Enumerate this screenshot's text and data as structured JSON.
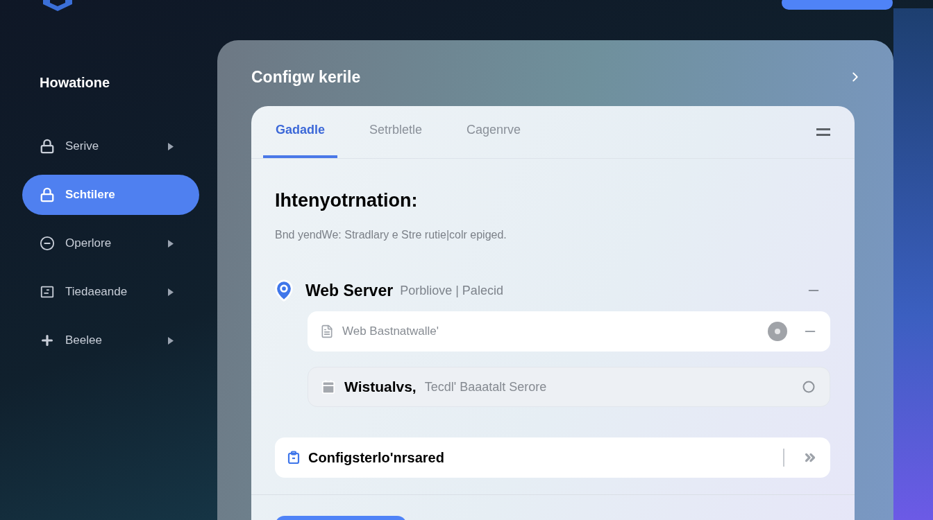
{
  "sidebar": {
    "heading": "Howatione",
    "items": [
      {
        "label": "Serive",
        "kind": "lock",
        "selected": false,
        "expandable": true
      },
      {
        "label": "Schtilere",
        "kind": "lock",
        "selected": true,
        "expandable": false
      },
      {
        "label": "Operlore",
        "kind": "minus-circle",
        "selected": false,
        "expandable": true
      },
      {
        "label": "Tiedaeande",
        "kind": "card",
        "selected": false,
        "expandable": true
      },
      {
        "label": "Beelee",
        "kind": "plus",
        "selected": false,
        "expandable": true
      }
    ]
  },
  "panel": {
    "title": "Configw kerile",
    "tabs": [
      {
        "label": "Gadadle",
        "selected": true
      },
      {
        "label": "Setrbletle",
        "selected": false
      },
      {
        "label": "Cagenrve",
        "selected": false
      }
    ],
    "heading": "Ihtenyotrnation:",
    "description": "Bnd yendWe: Stradlary e Stre rutie|colr epiged.",
    "section": {
      "title": "Web Server",
      "subtitle": "Porbliove | Palecid",
      "expanded": true,
      "rows": [
        {
          "kind": "input",
          "placeholder": "Web Bastnatwalle'"
        },
        {
          "kind": "select",
          "value": "Wistualvs,",
          "hint": "Tecdl' Baaatalt Serore"
        }
      ]
    },
    "config_field": {
      "value": "Configsterlo'nrsared"
    }
  }
}
